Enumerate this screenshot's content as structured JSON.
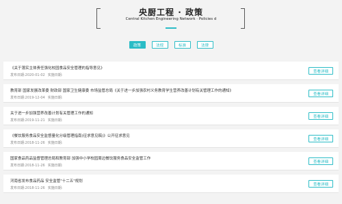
{
  "header": {
    "title": "央厨工程 · 政策",
    "subtitle": "Central Kitchen Engineering Network · Policies d"
  },
  "tabs": [
    {
      "label": "政策"
    },
    {
      "label": "法规"
    },
    {
      "label": "标准"
    },
    {
      "label": "法律"
    }
  ],
  "items": [
    {
      "title": "《关于落实主体责任强化校园食品安全管理的指导意见》",
      "date": "发布日期:2020-01-02",
      "impl": "实施日期:",
      "button": "查看详细"
    },
    {
      "title": "教育部 国家发展改革委 财政部 国家卫生健康委 市场监管总局《关于进一步加强农村义务教育学生营养改善计划有关管理工作的通知》",
      "date": "发布日期:2019-12-04",
      "impl": "实施日期:",
      "button": "查看详细"
    },
    {
      "title": "关于进一步加强营养改善计划有关管理工作的通知",
      "date": "发布日期:2019-11-21",
      "impl": "实施日期:",
      "button": "查看详细"
    },
    {
      "title": "《餐饮服务食品安全监督量化分级管理指南(征求意见稿)》公开征求意见",
      "date": "发布日期:2018-11-26",
      "impl": "实施日期:",
      "button": "查看详细"
    },
    {
      "title": "国家食品药品监督管理总局和教育部 加强中小学校园周边餐饮服务食品安全监管工作",
      "date": "发布日期:2018-11-26",
      "impl": "实施日期:",
      "button": "查看详细"
    },
    {
      "title": "河南省发布食品药品 安全监管\"十二五\"规划",
      "date": "发布日期:2018-11-26",
      "impl": "实施日期:",
      "button": "查看详细"
    }
  ]
}
